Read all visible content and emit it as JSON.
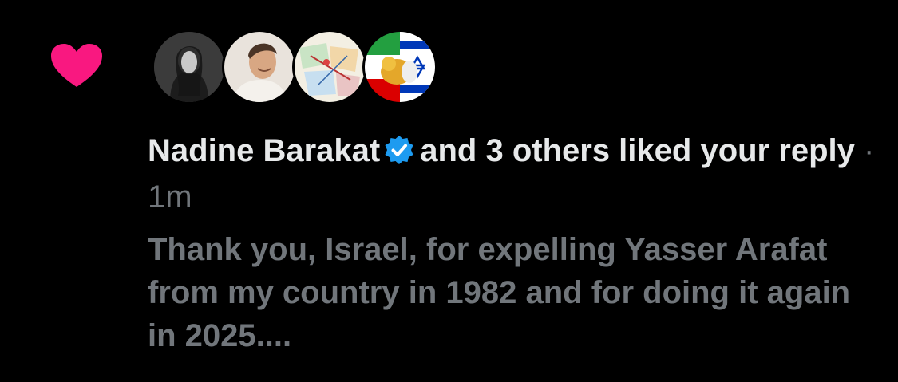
{
  "notification": {
    "actor_name": "Nadine Barakat",
    "verified": true,
    "action_text": "and 3 others liked your",
    "object_text": "reply",
    "separator": "·",
    "timestamp": "1m",
    "reply_excerpt": "Thank you, Israel, for expelling Yasser Arafat from my country in 1982 and for doing it again in 2025....",
    "icon": "heart-icon",
    "avatars": [
      {
        "name": "avatar-portrait-woman"
      },
      {
        "name": "avatar-portrait-man"
      },
      {
        "name": "avatar-map"
      },
      {
        "name": "avatar-flags-lion"
      }
    ]
  },
  "colors": {
    "background": "#000000",
    "heart": "#f91880",
    "verified_badge": "#1d9bf0",
    "primary_text": "#e7e9ea",
    "secondary_text": "#71767b"
  }
}
